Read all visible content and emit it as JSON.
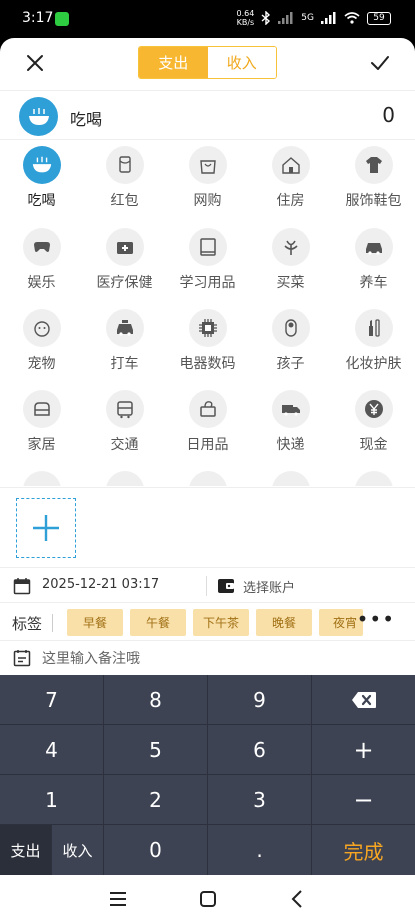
{
  "status_bar": {
    "time": "3:17",
    "net_speed_value": "0.64",
    "net_speed_unit": "KB/s",
    "network": "5G",
    "battery": "59"
  },
  "header": {
    "tab_expense": "支出",
    "tab_income": "收入"
  },
  "selected": {
    "category": "吃喝",
    "amount": "0"
  },
  "categories": [
    {
      "label": "吃喝",
      "icon": "bowl-icon"
    },
    {
      "label": "红包",
      "icon": "red-envelope-icon"
    },
    {
      "label": "网购",
      "icon": "shopping-bag-icon"
    },
    {
      "label": "住房",
      "icon": "house-icon"
    },
    {
      "label": "服饰鞋包",
      "icon": "tshirt-icon"
    },
    {
      "label": "娱乐",
      "icon": "gamepad-icon"
    },
    {
      "label": "医疗保健",
      "icon": "medical-kit-icon"
    },
    {
      "label": "学习用品",
      "icon": "book-icon"
    },
    {
      "label": "买菜",
      "icon": "vegetable-icon"
    },
    {
      "label": "养车",
      "icon": "car-icon"
    },
    {
      "label": "宠物",
      "icon": "pet-icon"
    },
    {
      "label": "打车",
      "icon": "taxi-icon"
    },
    {
      "label": "电器数码",
      "icon": "chip-icon"
    },
    {
      "label": "孩子",
      "icon": "baby-icon"
    },
    {
      "label": "化妆护肤",
      "icon": "cosmetics-icon"
    },
    {
      "label": "家居",
      "icon": "sofa-icon"
    },
    {
      "label": "交通",
      "icon": "bus-icon"
    },
    {
      "label": "日用品",
      "icon": "tissue-icon"
    },
    {
      "label": "快递",
      "icon": "truck-icon"
    },
    {
      "label": "现金",
      "icon": "yen-coin-icon"
    }
  ],
  "info": {
    "datetime": "2025-12-21 03:17",
    "account_placeholder": "选择账户"
  },
  "tags": {
    "title": "标签",
    "items": [
      "早餐",
      "午餐",
      "下午茶",
      "晚餐",
      "夜宵"
    ],
    "more": "•••"
  },
  "note": {
    "placeholder": "这里输入备注哦"
  },
  "keypad": {
    "k7": "7",
    "k8": "8",
    "k9": "9",
    "k4": "4",
    "k5": "5",
    "k6": "6",
    "plus": "+",
    "k1": "1",
    "k2": "2",
    "k3": "3",
    "minus": "−",
    "expense": "支出",
    "income": "收入",
    "k0": "0",
    "dot": ".",
    "done": "完成"
  },
  "colors": {
    "accent_yellow": "#f7b731",
    "accent_blue": "#2f9fd8",
    "keypad_bg": "#3d4352",
    "done_text": "#f6a623"
  }
}
